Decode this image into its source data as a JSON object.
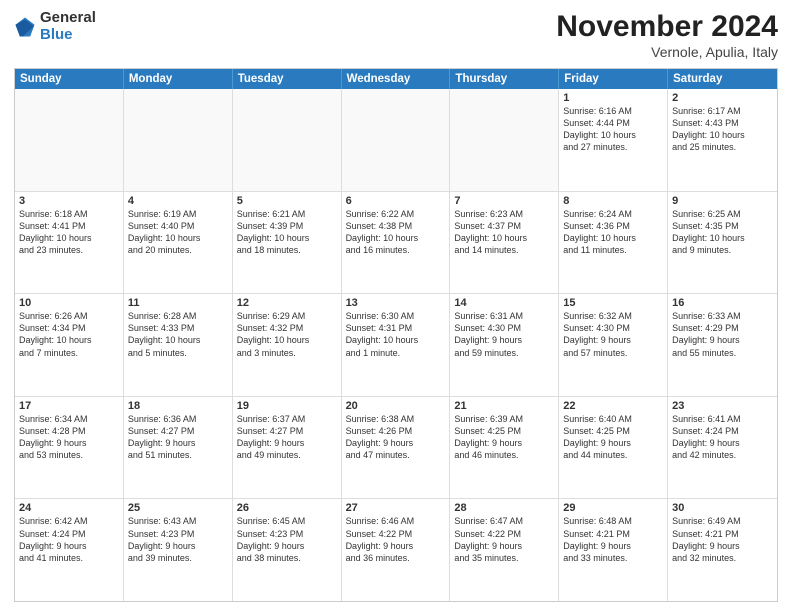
{
  "logo": {
    "general": "General",
    "blue": "Blue"
  },
  "title": "November 2024",
  "subtitle": "Vernole, Apulia, Italy",
  "header_days": [
    "Sunday",
    "Monday",
    "Tuesday",
    "Wednesday",
    "Thursday",
    "Friday",
    "Saturday"
  ],
  "rows": [
    [
      {
        "num": "",
        "info": "",
        "empty": true
      },
      {
        "num": "",
        "info": "",
        "empty": true
      },
      {
        "num": "",
        "info": "",
        "empty": true
      },
      {
        "num": "",
        "info": "",
        "empty": true
      },
      {
        "num": "",
        "info": "",
        "empty": true
      },
      {
        "num": "1",
        "info": "Sunrise: 6:16 AM\nSunset: 4:44 PM\nDaylight: 10 hours\nand 27 minutes.",
        "empty": false
      },
      {
        "num": "2",
        "info": "Sunrise: 6:17 AM\nSunset: 4:43 PM\nDaylight: 10 hours\nand 25 minutes.",
        "empty": false
      }
    ],
    [
      {
        "num": "3",
        "info": "Sunrise: 6:18 AM\nSunset: 4:41 PM\nDaylight: 10 hours\nand 23 minutes.",
        "empty": false
      },
      {
        "num": "4",
        "info": "Sunrise: 6:19 AM\nSunset: 4:40 PM\nDaylight: 10 hours\nand 20 minutes.",
        "empty": false
      },
      {
        "num": "5",
        "info": "Sunrise: 6:21 AM\nSunset: 4:39 PM\nDaylight: 10 hours\nand 18 minutes.",
        "empty": false
      },
      {
        "num": "6",
        "info": "Sunrise: 6:22 AM\nSunset: 4:38 PM\nDaylight: 10 hours\nand 16 minutes.",
        "empty": false
      },
      {
        "num": "7",
        "info": "Sunrise: 6:23 AM\nSunset: 4:37 PM\nDaylight: 10 hours\nand 14 minutes.",
        "empty": false
      },
      {
        "num": "8",
        "info": "Sunrise: 6:24 AM\nSunset: 4:36 PM\nDaylight: 10 hours\nand 11 minutes.",
        "empty": false
      },
      {
        "num": "9",
        "info": "Sunrise: 6:25 AM\nSunset: 4:35 PM\nDaylight: 10 hours\nand 9 minutes.",
        "empty": false
      }
    ],
    [
      {
        "num": "10",
        "info": "Sunrise: 6:26 AM\nSunset: 4:34 PM\nDaylight: 10 hours\nand 7 minutes.",
        "empty": false
      },
      {
        "num": "11",
        "info": "Sunrise: 6:28 AM\nSunset: 4:33 PM\nDaylight: 10 hours\nand 5 minutes.",
        "empty": false
      },
      {
        "num": "12",
        "info": "Sunrise: 6:29 AM\nSunset: 4:32 PM\nDaylight: 10 hours\nand 3 minutes.",
        "empty": false
      },
      {
        "num": "13",
        "info": "Sunrise: 6:30 AM\nSunset: 4:31 PM\nDaylight: 10 hours\nand 1 minute.",
        "empty": false
      },
      {
        "num": "14",
        "info": "Sunrise: 6:31 AM\nSunset: 4:30 PM\nDaylight: 9 hours\nand 59 minutes.",
        "empty": false
      },
      {
        "num": "15",
        "info": "Sunrise: 6:32 AM\nSunset: 4:30 PM\nDaylight: 9 hours\nand 57 minutes.",
        "empty": false
      },
      {
        "num": "16",
        "info": "Sunrise: 6:33 AM\nSunset: 4:29 PM\nDaylight: 9 hours\nand 55 minutes.",
        "empty": false
      }
    ],
    [
      {
        "num": "17",
        "info": "Sunrise: 6:34 AM\nSunset: 4:28 PM\nDaylight: 9 hours\nand 53 minutes.",
        "empty": false
      },
      {
        "num": "18",
        "info": "Sunrise: 6:36 AM\nSunset: 4:27 PM\nDaylight: 9 hours\nand 51 minutes.",
        "empty": false
      },
      {
        "num": "19",
        "info": "Sunrise: 6:37 AM\nSunset: 4:27 PM\nDaylight: 9 hours\nand 49 minutes.",
        "empty": false
      },
      {
        "num": "20",
        "info": "Sunrise: 6:38 AM\nSunset: 4:26 PM\nDaylight: 9 hours\nand 47 minutes.",
        "empty": false
      },
      {
        "num": "21",
        "info": "Sunrise: 6:39 AM\nSunset: 4:25 PM\nDaylight: 9 hours\nand 46 minutes.",
        "empty": false
      },
      {
        "num": "22",
        "info": "Sunrise: 6:40 AM\nSunset: 4:25 PM\nDaylight: 9 hours\nand 44 minutes.",
        "empty": false
      },
      {
        "num": "23",
        "info": "Sunrise: 6:41 AM\nSunset: 4:24 PM\nDaylight: 9 hours\nand 42 minutes.",
        "empty": false
      }
    ],
    [
      {
        "num": "24",
        "info": "Sunrise: 6:42 AM\nSunset: 4:24 PM\nDaylight: 9 hours\nand 41 minutes.",
        "empty": false
      },
      {
        "num": "25",
        "info": "Sunrise: 6:43 AM\nSunset: 4:23 PM\nDaylight: 9 hours\nand 39 minutes.",
        "empty": false
      },
      {
        "num": "26",
        "info": "Sunrise: 6:45 AM\nSunset: 4:23 PM\nDaylight: 9 hours\nand 38 minutes.",
        "empty": false
      },
      {
        "num": "27",
        "info": "Sunrise: 6:46 AM\nSunset: 4:22 PM\nDaylight: 9 hours\nand 36 minutes.",
        "empty": false
      },
      {
        "num": "28",
        "info": "Sunrise: 6:47 AM\nSunset: 4:22 PM\nDaylight: 9 hours\nand 35 minutes.",
        "empty": false
      },
      {
        "num": "29",
        "info": "Sunrise: 6:48 AM\nSunset: 4:21 PM\nDaylight: 9 hours\nand 33 minutes.",
        "empty": false
      },
      {
        "num": "30",
        "info": "Sunrise: 6:49 AM\nSunset: 4:21 PM\nDaylight: 9 hours\nand 32 minutes.",
        "empty": false
      }
    ]
  ]
}
